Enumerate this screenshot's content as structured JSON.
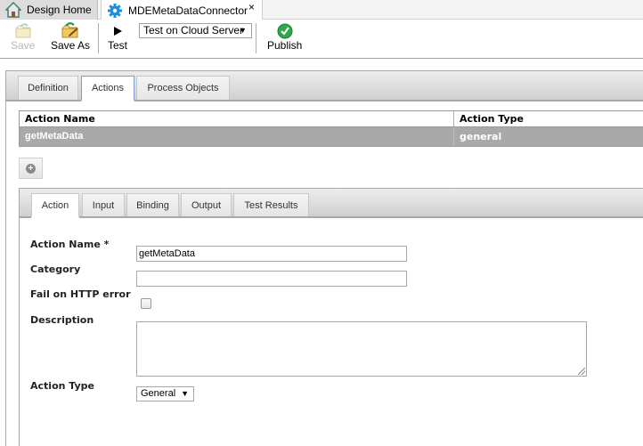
{
  "doc_tabs": [
    {
      "label": "Design Home",
      "icon": "home-icon"
    },
    {
      "label": "MDEMetaDataConnector",
      "icon": "gear-icon",
      "active": true,
      "close": "×"
    }
  ],
  "toolbar": {
    "save_label": "Save",
    "save_as_label": "Save As",
    "test_label": "Test",
    "test_target": "Test on Cloud Server",
    "publish_label": "Publish",
    "dropdown_arrow": "▼"
  },
  "main_tabs": [
    {
      "label": "Definition"
    },
    {
      "label": "Actions",
      "active": true
    },
    {
      "label": "Process Objects"
    }
  ],
  "actions_table": {
    "columns": [
      "Action Name",
      "Action Type"
    ],
    "rows": [
      {
        "name": "getMetaData",
        "type": "general",
        "selected": true
      }
    ]
  },
  "add_button": {
    "icon": "plus-circle-icon",
    "symbol": "+"
  },
  "action_tabs": [
    {
      "label": "Action",
      "active": true
    },
    {
      "label": "Input"
    },
    {
      "label": "Binding"
    },
    {
      "label": "Output"
    },
    {
      "label": "Test Results"
    }
  ],
  "action_form": {
    "action_name_label": "Action Name *",
    "action_name_value": "getMetaData",
    "category_label": "Category",
    "category_value": "",
    "fail_on_http_label": "Fail on HTTP error",
    "fail_on_http_checked": false,
    "description_label": "Description",
    "description_value": "",
    "action_type_label": "Action Type",
    "action_type_value": "General",
    "dropdown_arrow": "▼"
  },
  "colors": {
    "selected_row": "#a9a9a9",
    "active_tab_border": "#7a9cd3",
    "publish_green": "#2ea84a",
    "gear_blue": "#1e8fe0"
  }
}
